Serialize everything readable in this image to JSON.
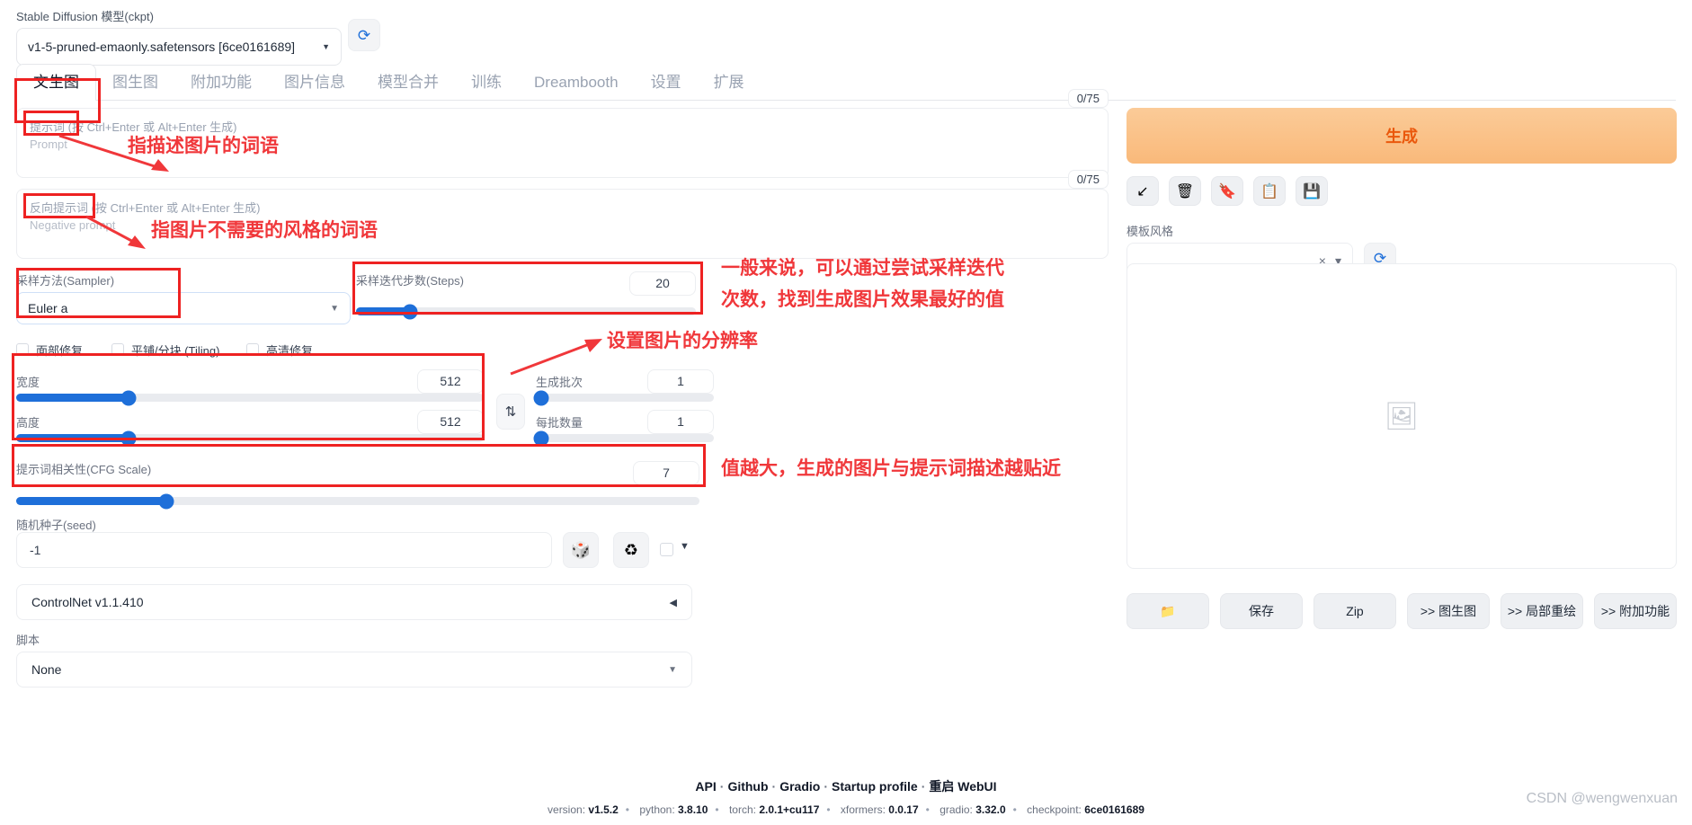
{
  "model": {
    "label": "Stable Diffusion 模型(ckpt)",
    "value": "v1-5-pruned-emaonly.safetensors [6ce0161689]",
    "refresh_icon": "refresh-icon"
  },
  "tabs": [
    {
      "label": "文生图",
      "active": true
    },
    {
      "label": "图生图",
      "active": false
    },
    {
      "label": "附加功能",
      "active": false
    },
    {
      "label": "图片信息",
      "active": false
    },
    {
      "label": "模型合并",
      "active": false
    },
    {
      "label": "训练",
      "active": false
    },
    {
      "label": "Dreambooth",
      "active": false
    },
    {
      "label": "设置",
      "active": false
    },
    {
      "label": "扩展",
      "active": false
    }
  ],
  "prompt": {
    "label_cn": "提示词",
    "hint": "(按 Ctrl+Enter 或 Alt+Enter 生成)",
    "label_en": "Prompt",
    "value": "",
    "counter": "0/75"
  },
  "negative_prompt": {
    "label_cn": "反向提示词",
    "hint": "(按 Ctrl+Enter 或 Alt+Enter 生成)",
    "label_en": "Negative prompt",
    "value": "",
    "counter": "0/75"
  },
  "sampler": {
    "label": "采样方法(Sampler)",
    "value": "Euler a"
  },
  "steps": {
    "label": "采样迭代步数(Steps)",
    "value": "20",
    "fill_percent": 16
  },
  "checkboxes": [
    {
      "label": "面部修复",
      "checked": false
    },
    {
      "label": "平铺/分块 (Tiling)",
      "checked": false
    },
    {
      "label": "高清修复",
      "checked": false
    }
  ],
  "width": {
    "label": "宽度",
    "value": "512",
    "fill_percent": 24
  },
  "height": {
    "label": "高度",
    "value": "512",
    "fill_percent": 24
  },
  "swap_icon": "swap-arrows-icon",
  "batch_count": {
    "label": "生成批次",
    "value": "1",
    "fill_percent": 2
  },
  "batch_size": {
    "label": "每批数量",
    "value": "1",
    "fill_percent": 2
  },
  "cfg": {
    "label": "提示词相关性(CFG Scale)",
    "value": "7",
    "fill_percent": 22
  },
  "seed": {
    "label": "随机种子(seed)",
    "value": "-1",
    "dice_icon": "dice-icon",
    "recycle_icon": "recycle-icon",
    "extra_checkbox": false,
    "caret": "▼"
  },
  "controlnet": {
    "label": "ControlNet v1.1.410",
    "caret": "◀"
  },
  "script": {
    "label": "脚本",
    "value": "None"
  },
  "generate": {
    "label": "生成"
  },
  "tool_buttons": [
    {
      "name": "arrow-into-box-icon",
      "glyph": "↙"
    },
    {
      "name": "trash-icon",
      "glyph": "🗑"
    },
    {
      "name": "recycle-bin-icon",
      "glyph": "🔖"
    },
    {
      "name": "clipboard-icon",
      "glyph": "📋"
    },
    {
      "name": "save-floppy-icon",
      "glyph": "💾"
    }
  ],
  "styles": {
    "label": "模板风格",
    "value": "",
    "clear_icon": "×",
    "caret": "▾",
    "refresh_icon": "refresh-icon"
  },
  "gallery": {
    "placeholder_icon": "image-placeholder-icon"
  },
  "output_buttons": [
    {
      "label": "",
      "icon": "folder-icon",
      "name": "open-folder-button"
    },
    {
      "label": "保存",
      "icon": "",
      "name": "save-button"
    },
    {
      "label": "Zip",
      "icon": "",
      "name": "zip-button"
    },
    {
      "label": ">> 图生图",
      "icon": "",
      "name": "send-to-img2img-button"
    },
    {
      "label": ">> 局部重绘",
      "icon": "",
      "name": "send-to-inpaint-button"
    },
    {
      "label": ">> 附加功能",
      "icon": "",
      "name": "send-to-extras-button"
    }
  ],
  "annotations": [
    {
      "id": "prompt-note",
      "text": "指描述图片的词语"
    },
    {
      "id": "negative-note",
      "text": "指图片不需要的风格的词语"
    },
    {
      "id": "resolution-note",
      "text": "设置图片的分辨率"
    },
    {
      "id": "steps-note-line1",
      "text": "一般来说，可以通过尝试采样迭代"
    },
    {
      "id": "steps-note-line2",
      "text": "次数，找到生成图片效果最好的值"
    },
    {
      "id": "cfg-note",
      "text": "值越大，生成的图片与提示词描述越贴近"
    }
  ],
  "footer": {
    "links": [
      "API",
      "Github",
      "Gradio",
      "Startup profile",
      "重启 WebUI"
    ],
    "separator": "·",
    "version_items": [
      {
        "key": "version:",
        "val": "v1.5.2"
      },
      {
        "key": "python:",
        "val": "3.8.10"
      },
      {
        "key": "torch:",
        "val": "2.0.1+cu117"
      },
      {
        "key": "xformers:",
        "val": "0.0.17"
      },
      {
        "key": "gradio:",
        "val": "3.32.0"
      },
      {
        "key": "checkpoint:",
        "val": "6ce0161689"
      }
    ]
  },
  "watermark": "CSDN @wengwenxuan",
  "colors": {
    "accent_blue": "#1e6fd9",
    "annotation_red": "#f0373a",
    "generate_orange": "#ea580c"
  }
}
